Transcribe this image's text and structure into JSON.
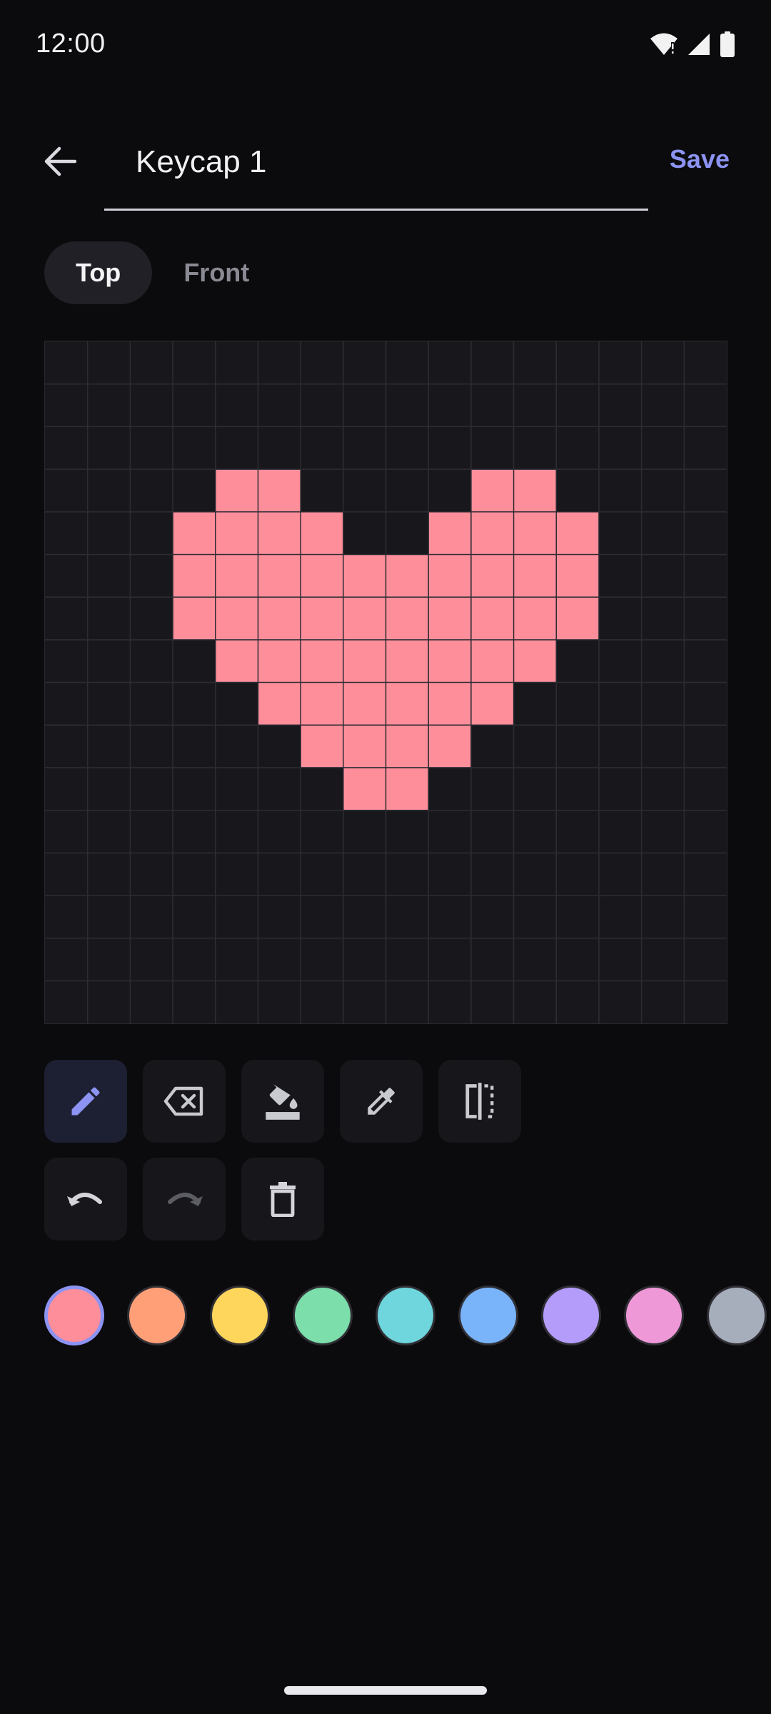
{
  "status_bar": {
    "time": "12:00"
  },
  "header": {
    "title_value": "Keycap 1",
    "save_label": "Save"
  },
  "tabs": [
    {
      "label": "Top",
      "active": true
    },
    {
      "label": "Front",
      "active": false
    }
  ],
  "canvas": {
    "grid_size": 16,
    "background": "#18181c",
    "grid_line_color": "#2c2c33",
    "pixel_color": "#ff8e9b",
    "filled_rows": [
      {
        "row": 3,
        "cols": [
          4,
          5,
          10,
          11
        ]
      },
      {
        "row": 4,
        "cols": [
          3,
          4,
          5,
          6,
          9,
          10,
          11,
          12
        ]
      },
      {
        "row": 5,
        "cols": [
          3,
          4,
          5,
          6,
          7,
          8,
          9,
          10,
          11,
          12
        ]
      },
      {
        "row": 6,
        "cols": [
          3,
          4,
          5,
          6,
          7,
          8,
          9,
          10,
          11,
          12
        ]
      },
      {
        "row": 7,
        "cols": [
          4,
          5,
          6,
          7,
          8,
          9,
          10,
          11
        ]
      },
      {
        "row": 8,
        "cols": [
          5,
          6,
          7,
          8,
          9,
          10
        ]
      },
      {
        "row": 9,
        "cols": [
          6,
          7,
          8,
          9
        ]
      },
      {
        "row": 10,
        "cols": [
          7,
          8
        ]
      }
    ]
  },
  "tools": [
    {
      "name": "pencil",
      "icon": "pencil-icon",
      "active": true
    },
    {
      "name": "eraser",
      "icon": "backspace-eraser-icon",
      "active": false
    },
    {
      "name": "fill",
      "icon": "paint-bucket-icon",
      "active": false
    },
    {
      "name": "eyedropper",
      "icon": "eyedropper-icon",
      "active": false
    },
    {
      "name": "mirror",
      "icon": "mirror-icon",
      "active": false
    },
    {
      "name": "undo",
      "icon": "undo-icon",
      "active": false
    },
    {
      "name": "redo",
      "icon": "redo-icon",
      "disabled": true
    },
    {
      "name": "clear",
      "icon": "trash-icon",
      "active": false
    }
  ],
  "palette": {
    "selected_index": 0,
    "colors": [
      "#ff8e9b",
      "#ff9f78",
      "#ffd65c",
      "#7cdeab",
      "#6fd6dd",
      "#79b4fb",
      "#b49cfb",
      "#ef98d8",
      "#a6adbb"
    ]
  },
  "accent_color": "#8c93f2"
}
